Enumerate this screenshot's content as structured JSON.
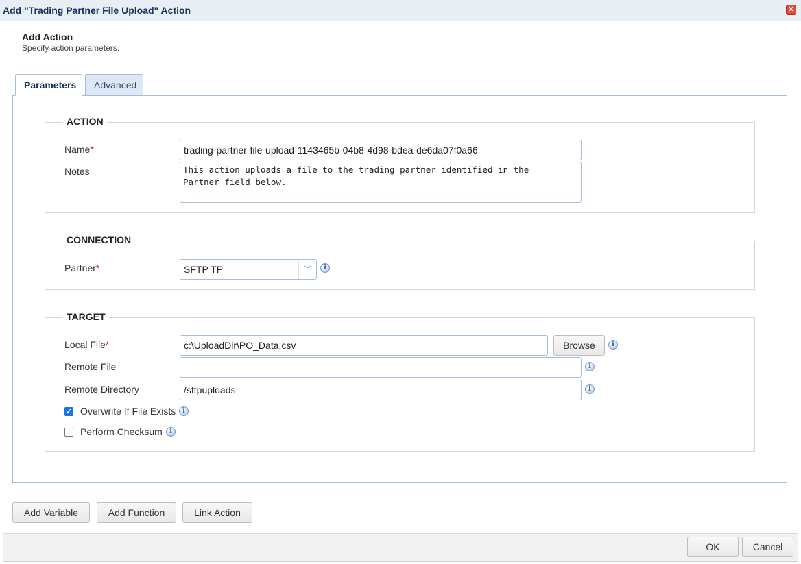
{
  "window": {
    "title": "Add \"Trading Partner File Upload\" Action"
  },
  "header": {
    "title": "Add Action",
    "subtitle": "Specify action parameters."
  },
  "tabs": [
    {
      "label": "Parameters"
    },
    {
      "label": "Advanced"
    }
  ],
  "sections": {
    "action": {
      "legend": "ACTION",
      "name_label": "Name",
      "name_value": "trading-partner-file-upload-1143465b-04b8-4d98-bdea-de6da07f0a66",
      "notes_label": "Notes",
      "notes_value": "This action uploads a file to the trading partner identified in the\nPartner field below."
    },
    "connection": {
      "legend": "CONNECTION",
      "partner_label": "Partner",
      "partner_value": "SFTP TP"
    },
    "target": {
      "legend": "TARGET",
      "local_file_label": "Local File",
      "local_file_value": "c:\\UploadDir\\PO_Data.csv",
      "browse_label": "Browse",
      "remote_file_label": "Remote File",
      "remote_file_value": "",
      "remote_dir_label": "Remote Directory",
      "remote_dir_value": "/sftpuploads",
      "overwrite_label": "Overwrite If File Exists",
      "overwrite_checked": true,
      "checksum_label": "Perform Checksum",
      "checksum_checked": false
    }
  },
  "required_marker": "*",
  "bottom_buttons": {
    "add_variable": "Add Variable",
    "add_function": "Add Function",
    "link_action": "Link Action"
  },
  "footer": {
    "ok": "OK",
    "cancel": "Cancel"
  },
  "icons": {
    "close": "close-icon",
    "info": "info-icon",
    "dropdown": "chevron-down-icon",
    "checkmark": "checkmark-icon"
  },
  "colors": {
    "accent": "#1a73e8",
    "border": "#a5bdd8",
    "required": "#d0201a",
    "title": "#15315a"
  }
}
